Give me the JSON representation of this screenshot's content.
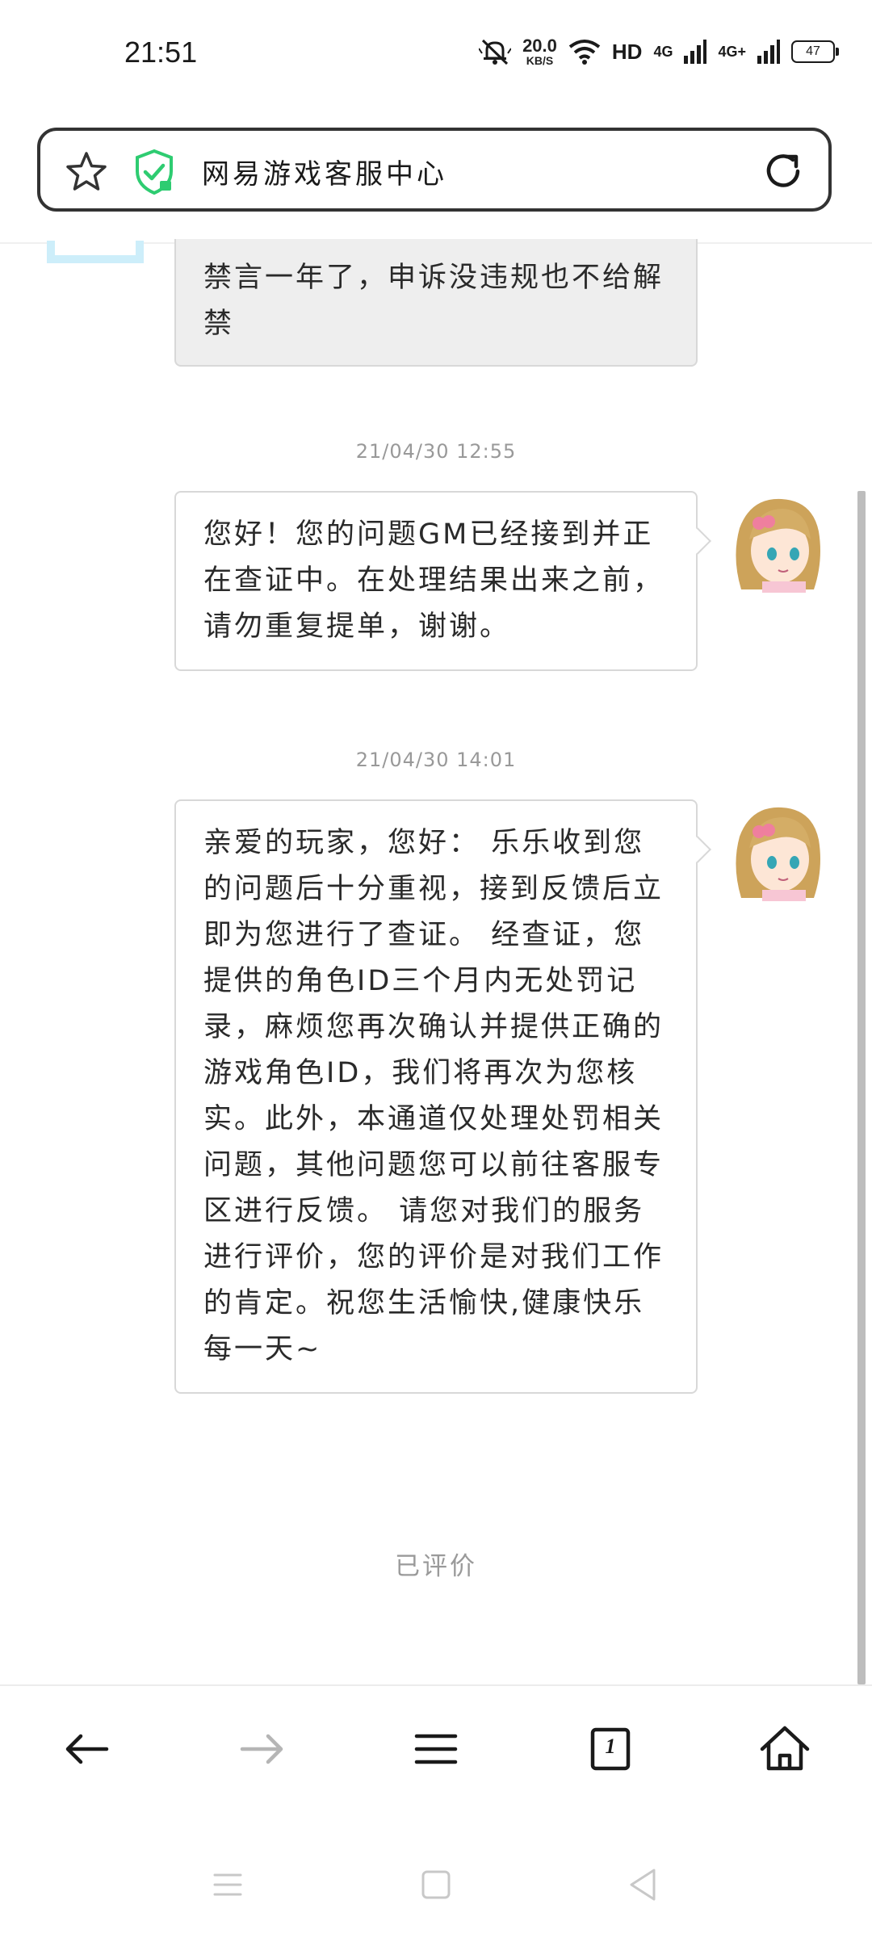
{
  "status_bar": {
    "time": "21:51",
    "net_speed_value": "20.0",
    "net_speed_unit": "KB/S",
    "hd_label": "HD",
    "sim1_label": "4G",
    "sim2_label": "4G+",
    "battery": "47"
  },
  "address_bar": {
    "title": "网易游戏客服中心",
    "icons": [
      "star-icon",
      "shield-check-icon",
      "refresh-icon"
    ],
    "shield_color": "#2ecc71"
  },
  "conversation": {
    "user_message_partial": "禁言一年了，申诉没违规也不给解禁",
    "messages": [
      {
        "timestamp": "21/04/30 12:55",
        "text": "您好！您的问题GM已经接到并正在查证中。在处理结果出来之前，请勿重复提单，谢谢。"
      },
      {
        "timestamp": "21/04/30 14:01",
        "text": "亲爱的玩家，您好：        乐乐收到您的问题后十分重视，接到反馈后立即为您进行了查证。        经查证，您提供的角色ID三个月内无处罚记录，麻烦您再次确认并提供正确的游戏角色ID，我们将再次为您核实。此外，本通道仅处理处罚相关问题，其他问题您可以前往客服专区进行反馈。        请您对我们的服务进行评价，您的评价是对我们工作的肯定。祝您生活愉快,健康快乐每一天~"
      }
    ],
    "rated_label": "已评价"
  },
  "bottom_nav": {
    "items": [
      "back-arrow-icon",
      "forward-arrow-icon",
      "menu-icon",
      "tabs-icon",
      "home-icon"
    ],
    "tab_count": "1"
  },
  "system_nav": {
    "items": [
      "recents-icon",
      "home-square-icon",
      "back-triangle-icon"
    ]
  }
}
